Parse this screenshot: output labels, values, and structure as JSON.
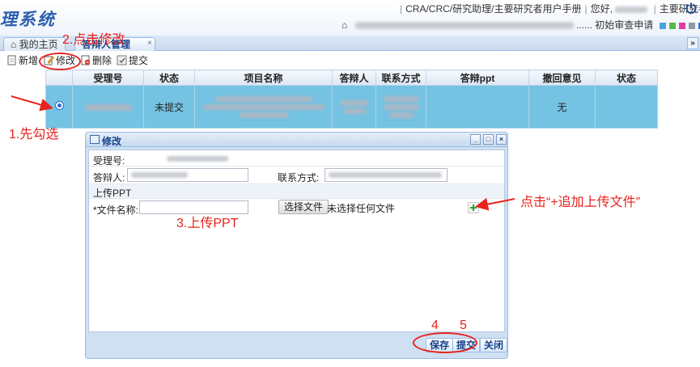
{
  "header": {
    "logo_text": "理系统",
    "links": [
      "CRA/CRC/研究助理/主要研究者用户手册",
      "您好,",
      "主要研究者"
    ],
    "initial_review": "初始审查申请",
    "theme_colors": [
      "#4aa3df",
      "#55b84b",
      "#e03ca6",
      "#8e9aa6",
      "#2f6fce"
    ]
  },
  "tabs": {
    "home": "我的主页",
    "defense": "答辩人管理",
    "close": "×",
    "scroll": "»"
  },
  "toolbar": {
    "new": "新增",
    "edit": "修改",
    "delete": "删除",
    "submit": "提交"
  },
  "grid": {
    "headers": [
      "",
      "受理号",
      "状态",
      "项目名称",
      "答辩人",
      "联系方式",
      "答辩ppt",
      "撤回意见",
      "状态"
    ],
    "rows": [
      {
        "status": "未提交",
        "withdraw": "无"
      }
    ]
  },
  "dialog": {
    "title": "修改",
    "accept_no_label": "受理号:",
    "defender_label": "答辩人:",
    "contact_label": "联系方式:",
    "upload_section": "上传PPT",
    "file_name_label": "*文件名称:",
    "choose_file": "选择文件",
    "no_file": "未选择任何文件",
    "save": "保存",
    "submit": "提交",
    "close": "关闭"
  },
  "annotations": {
    "step1": "1.先勾选",
    "step2": "2.点击修改",
    "step3": "3.上传PPT",
    "step4": "4",
    "step5": "5",
    "add_hint": "点击“+追加上传文件”"
  }
}
